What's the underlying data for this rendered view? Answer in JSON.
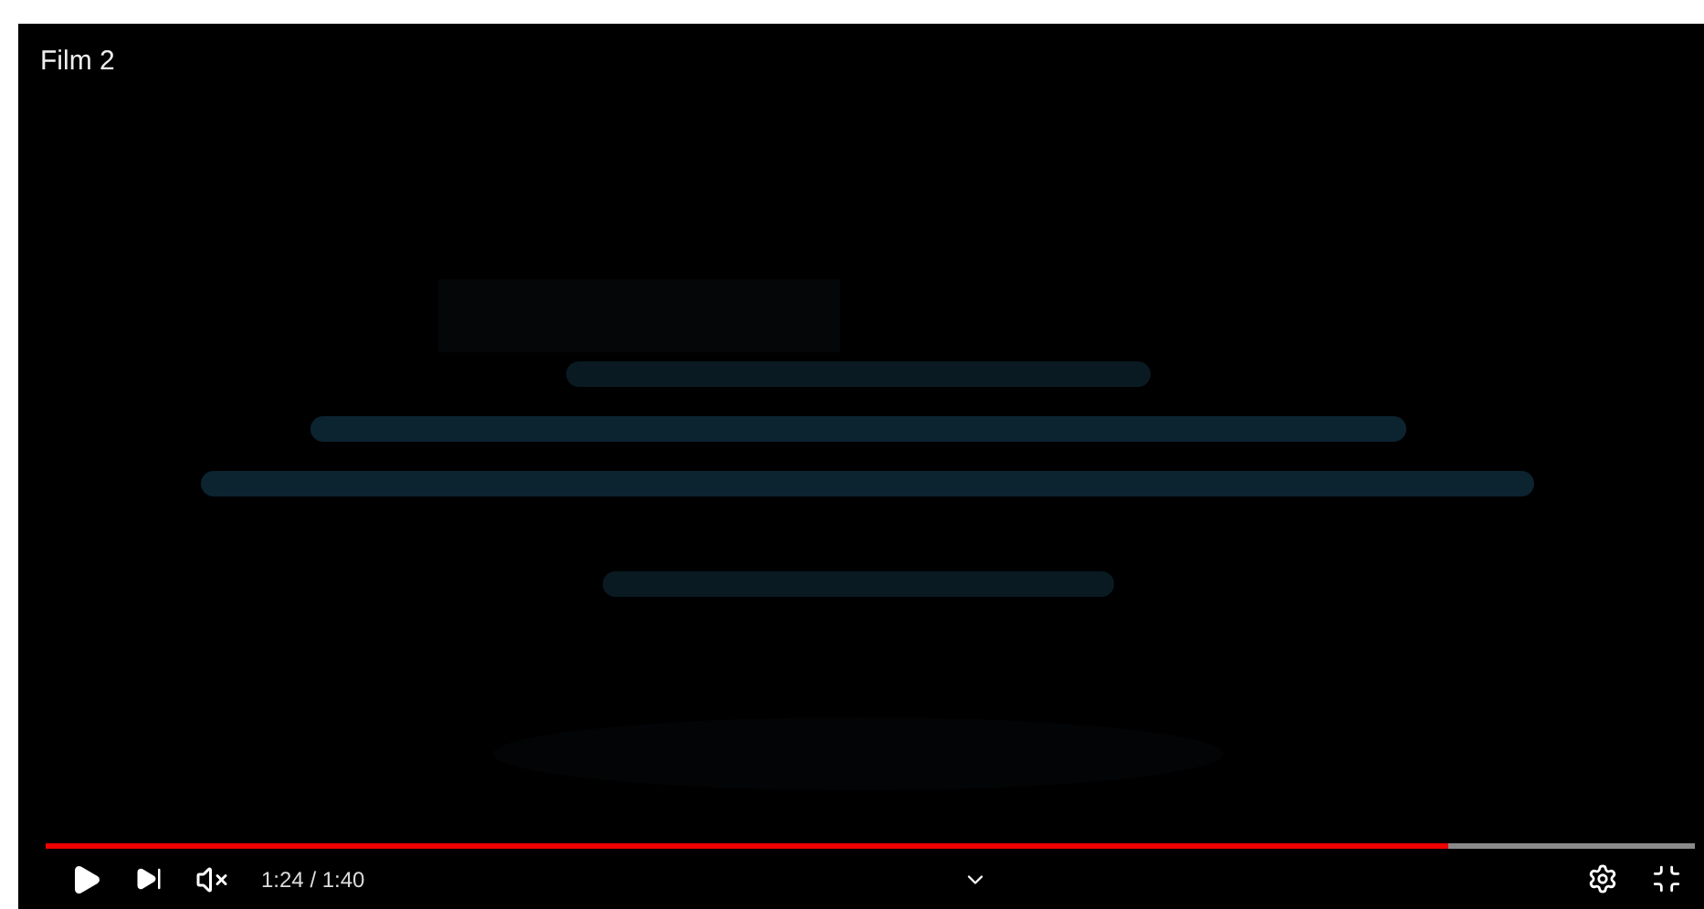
{
  "player": {
    "title": "Film 2",
    "progress": {
      "level": 0.85
    },
    "playing": false,
    "muted": true,
    "time": "1:24 / 1:40"
  }
}
